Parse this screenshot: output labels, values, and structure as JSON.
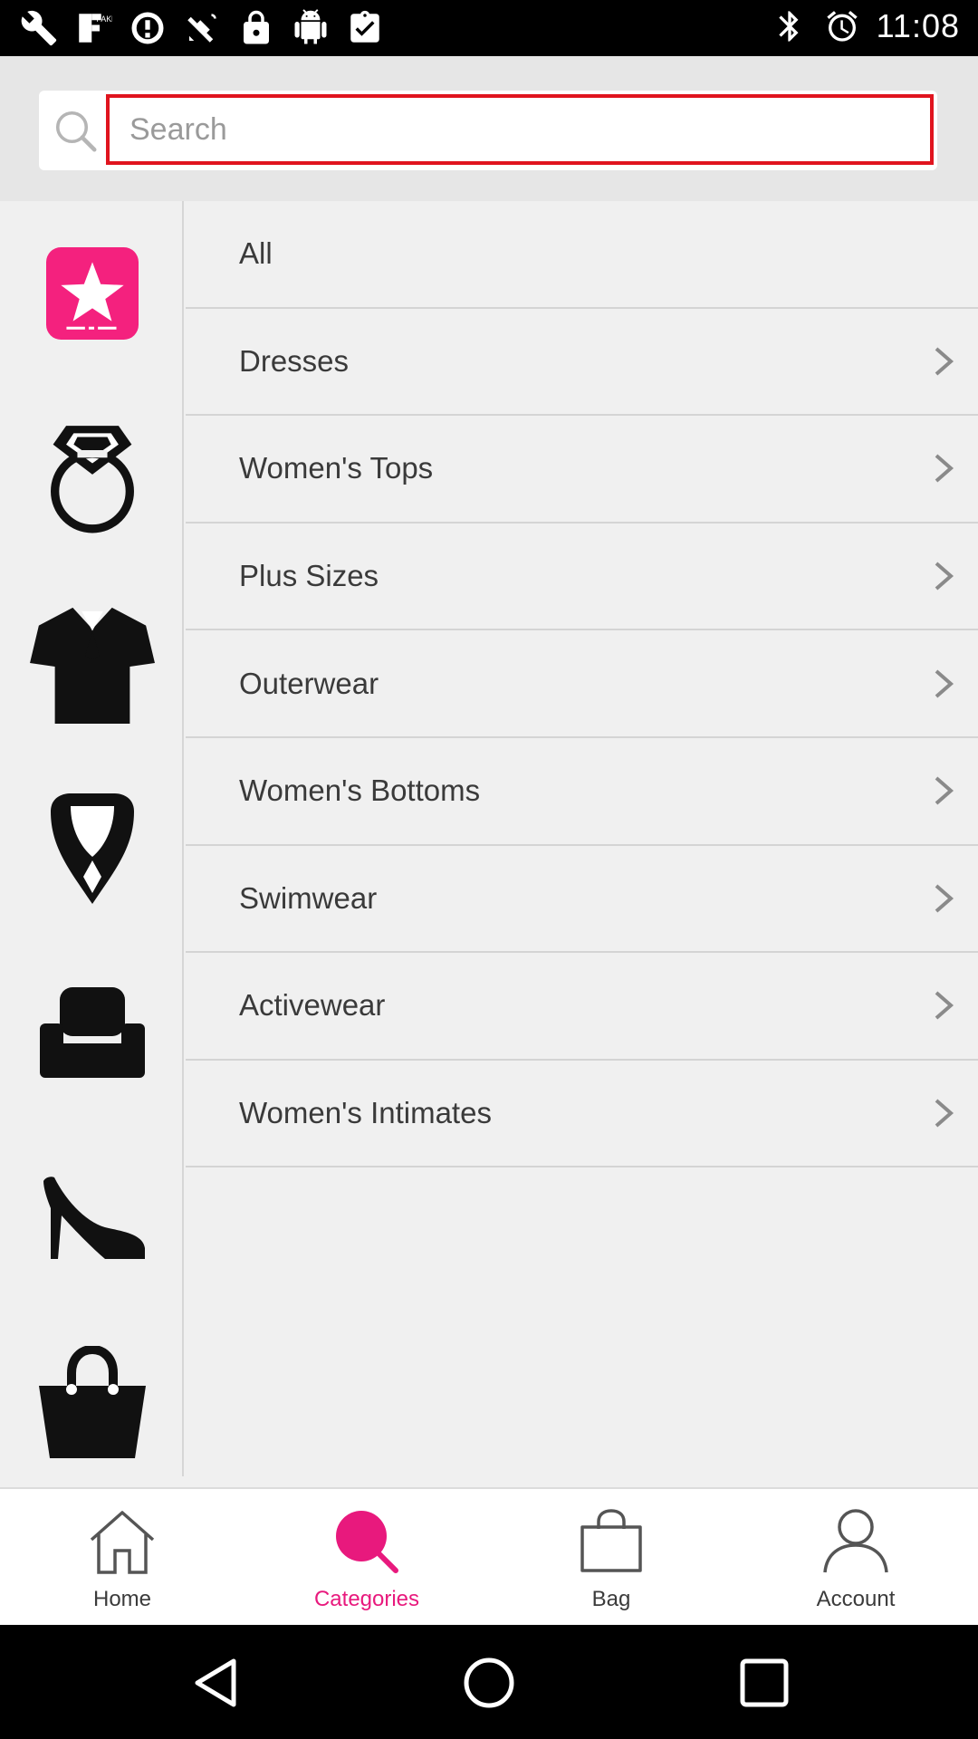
{
  "status_bar": {
    "time": "11:08",
    "left_icons": [
      "wrench-icon",
      "fake-gps-icon",
      "sync-icon",
      "satellite-icon",
      "lock-icon",
      "android-icon",
      "clipboard-check-icon"
    ],
    "right_icons": [
      "bluetooth-icon",
      "alarm-icon",
      "signal-icon",
      "battery-icon"
    ]
  },
  "search": {
    "placeholder": "Search",
    "value": ""
  },
  "side_icons": [
    "featured-star-icon",
    "ring-icon",
    "top-shirt-icon",
    "necklace-icon",
    "sofa-icon",
    "high-heel-icon",
    "handbag-icon"
  ],
  "categories": [
    {
      "label": "All",
      "has_chevron": false
    },
    {
      "label": "Dresses",
      "has_chevron": true
    },
    {
      "label": "Women's Tops",
      "has_chevron": true
    },
    {
      "label": "Plus Sizes",
      "has_chevron": true
    },
    {
      "label": "Outerwear",
      "has_chevron": true
    },
    {
      "label": "Women's Bottoms",
      "has_chevron": true
    },
    {
      "label": "Swimwear",
      "has_chevron": true
    },
    {
      "label": "Activewear",
      "has_chevron": true
    },
    {
      "label": "Women's Intimates",
      "has_chevron": true
    }
  ],
  "bottom_nav": {
    "items": [
      {
        "label": "Home",
        "icon": "home-icon",
        "active": false
      },
      {
        "label": "Categories",
        "icon": "categories-search-icon",
        "active": true
      },
      {
        "label": "Bag",
        "icon": "bag-icon",
        "active": false
      },
      {
        "label": "Account",
        "icon": "account-icon",
        "active": false
      }
    ]
  },
  "colors": {
    "accent": "#e8197d",
    "search_border": "#e0141e",
    "background": "#f0f0f0"
  }
}
